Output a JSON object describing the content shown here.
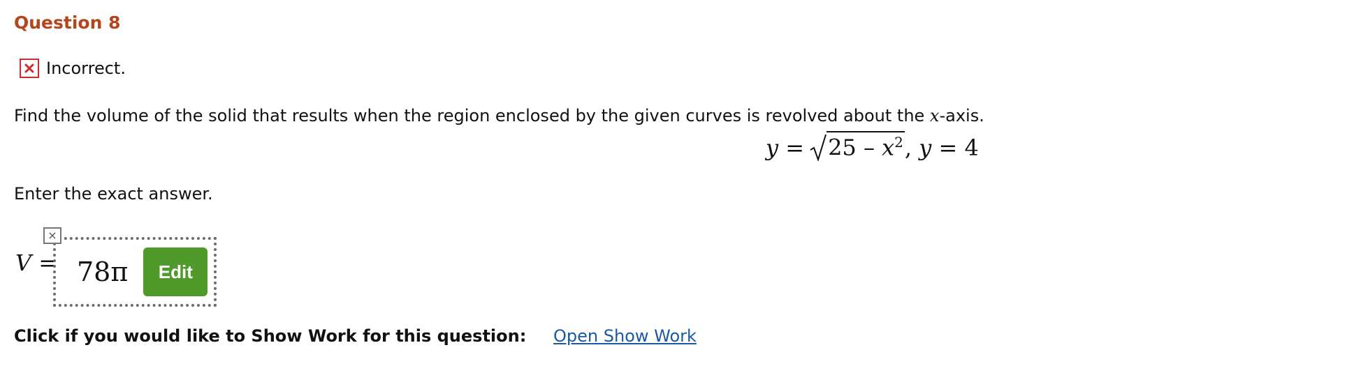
{
  "question": {
    "title": "Question 8",
    "status_text": "Incorrect.",
    "prompt_before": "Find the volume of the solid that results when the region enclosed by the given curves is revolved about the ",
    "prompt_variable": "x",
    "prompt_after": "-axis.",
    "equation": {
      "lhs": "y =",
      "radicand_start": "25 – ",
      "radicand_var": "x",
      "exponent": "2",
      "rhs": ", y = 4"
    },
    "instruction": "Enter the exact answer."
  },
  "answer": {
    "variable_label": "V =",
    "value": "78π",
    "edit_label": "Edit",
    "clear_icon": "×"
  },
  "show_work": {
    "prompt": "Click if you would like to Show Work for this question:",
    "link_label": "Open Show Work"
  },
  "colors": {
    "title": "#b5451b",
    "incorrect": "#c9302c",
    "edit_button": "#4f9a2a",
    "link": "#1a5aa5"
  },
  "icons": {
    "status": "x-mark-icon",
    "clear": "close-icon"
  }
}
